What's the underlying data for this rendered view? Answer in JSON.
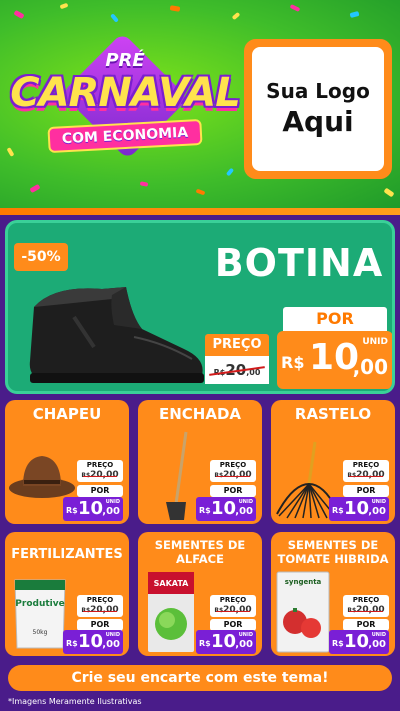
{
  "header": {
    "brand_pre": "PRÉ",
    "brand_main": "CARNAVAL",
    "brand_sub": "COM ECONOMIA",
    "logo_line1": "Sua Logo",
    "logo_line2": "Aqui"
  },
  "hero": {
    "discount": "-50%",
    "title": "BOTINA",
    "preco_label": "PREÇO",
    "old_price_currency": "R$",
    "old_price_main": "20",
    "old_price_cents": ",00",
    "por_label": "POR",
    "new_price_currency": "R$",
    "new_price_main": "10",
    "new_price_cents": ",00",
    "unit": "UNID"
  },
  "products": [
    {
      "name": "CHAPEU",
      "preco_label": "PREÇO",
      "old_price": "20,00",
      "old_currency": "R$",
      "por_label": "POR",
      "currency": "R$",
      "price_main": "10",
      "price_cents": ",00",
      "unit": "UNID",
      "icon": "cowboy-hat-icon"
    },
    {
      "name": "ENCHADA",
      "preco_label": "PREÇO",
      "old_price": "20,00",
      "old_currency": "R$",
      "por_label": "POR",
      "currency": "R$",
      "price_main": "10",
      "price_cents": ",00",
      "unit": "UNID",
      "icon": "hoe-icon"
    },
    {
      "name": "RASTELO",
      "preco_label": "PREÇO",
      "old_price": "20,00",
      "old_currency": "R$",
      "por_label": "POR",
      "currency": "R$",
      "price_main": "10",
      "price_cents": ",00",
      "unit": "UNID",
      "icon": "rake-icon"
    },
    {
      "name": "FERTILIZANTES",
      "preco_label": "PREÇO",
      "old_price": "20,00",
      "old_currency": "R$",
      "por_label": "POR",
      "currency": "R$",
      "price_main": "10",
      "price_cents": ",00",
      "unit": "UNID",
      "icon": "fertilizer-bag-icon",
      "package_text": "Produtive",
      "package_weight": "50kg"
    },
    {
      "name": "SEMENTES DE ALFACE",
      "preco_label": "PREÇO",
      "old_price": "20,00",
      "old_currency": "R$",
      "por_label": "POR",
      "currency": "R$",
      "price_main": "10",
      "price_cents": ",00",
      "unit": "UNID",
      "icon": "seed-packet-icon",
      "package_text": "SAKATA"
    },
    {
      "name": "SEMENTES DE TOMATE HIBRIDA",
      "preco_label": "PREÇO",
      "old_price": "20,00",
      "old_currency": "R$",
      "por_label": "POR",
      "currency": "R$",
      "price_main": "10",
      "price_cents": ",00",
      "unit": "UNID",
      "icon": "seed-packet-icon",
      "package_text": "syngenta"
    }
  ],
  "footer": {
    "cta": "Crie seu encarte com este tema!",
    "disclaimer": "*Imagens Meramente Ilustrativas"
  },
  "colors": {
    "orange": "#ff8b1a",
    "purple": "#7a1fd6",
    "green": "#1cab76",
    "header_green": "#3fbd2a"
  }
}
